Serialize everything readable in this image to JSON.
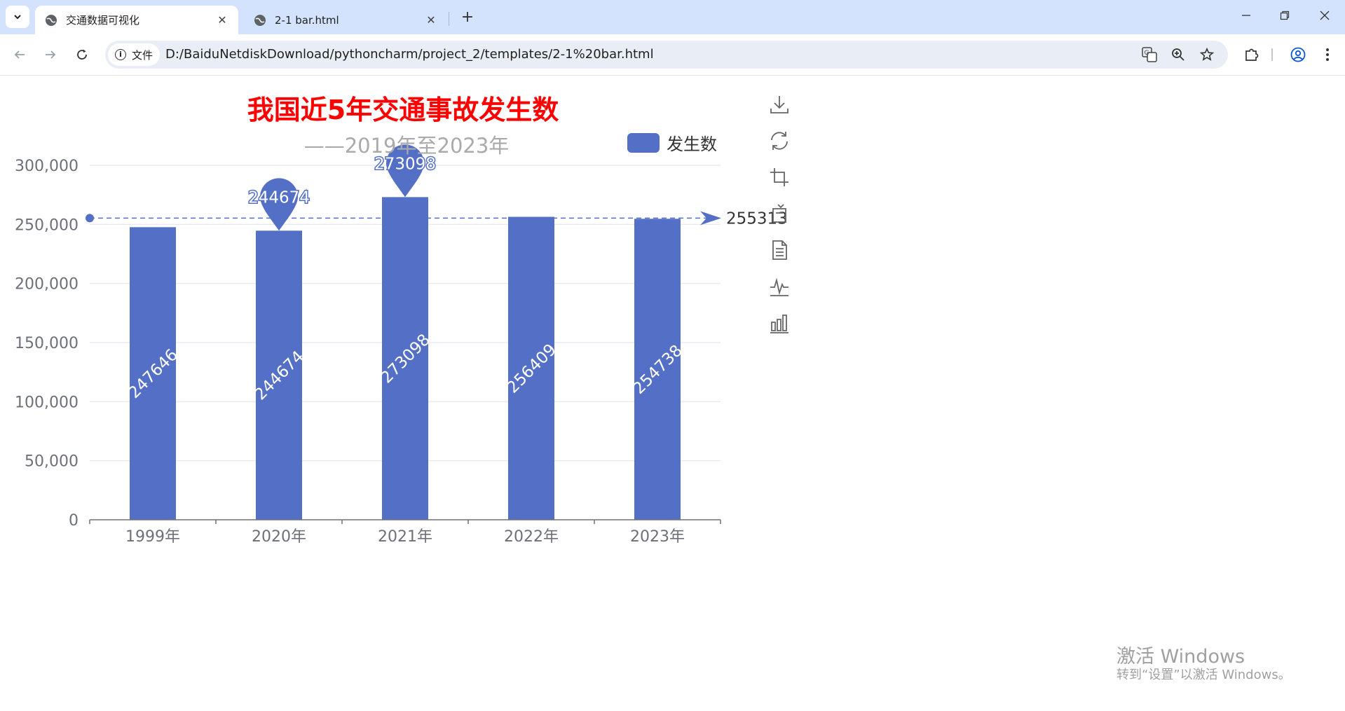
{
  "browser": {
    "tabs": [
      {
        "title": "交通数据可视化",
        "active": true
      },
      {
        "title": "2-1 bar.html",
        "active": false
      }
    ],
    "address": {
      "chip_label": "文件",
      "url": "D:/BaiduNetdiskDownload/pythoncharm/project_2/templates/2-1%20bar.html"
    }
  },
  "chart_data": {
    "type": "bar",
    "title": "我国近5年交通事故发生数",
    "subtitle": "——2019年至2023年",
    "categories": [
      "1999年",
      "2020年",
      "2021年",
      "2022年",
      "2023年"
    ],
    "series": [
      {
        "name": "发生数",
        "values": [
          247646,
          244674,
          273098,
          256409,
          254738
        ],
        "color": "#5470c6"
      }
    ],
    "ylim": [
      0,
      300000
    ],
    "yticks": [
      0,
      50000,
      100000,
      150000,
      200000,
      250000,
      300000
    ],
    "ytick_labels": [
      "0",
      "50,000",
      "100,000",
      "150,000",
      "200,000",
      "250,000",
      "300,000"
    ],
    "grid": "horizontal",
    "legend_position": "top-right",
    "mark_points": [
      {
        "type": "min",
        "category": "2020年",
        "value": 244674
      },
      {
        "type": "max",
        "category": "2021年",
        "value": 273098
      }
    ],
    "mark_line": {
      "type": "average",
      "value": 255313,
      "label": "255313"
    },
    "data_label_rotation": -45
  },
  "toolbox": [
    "download-icon",
    "refresh-icon",
    "crop-icon",
    "data-view-icon",
    "document-icon",
    "line-chart-icon",
    "bar-chart-icon"
  ],
  "watermark": {
    "title": "激活 Windows",
    "subtitle": "转到“设置”以激活 Windows。"
  }
}
